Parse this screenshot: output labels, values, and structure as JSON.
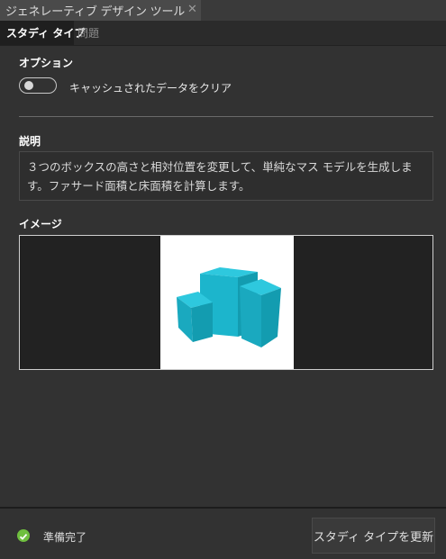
{
  "window": {
    "title": "ジェネレーティブ デザイン ツール",
    "close_glyph": "✕"
  },
  "tabs": [
    {
      "label": "スタディ タイプ",
      "active": true
    },
    {
      "label": "問題",
      "active": false
    }
  ],
  "options": {
    "heading": "オプション",
    "toggle_label": "キャッシュされたデータをクリア",
    "toggle_on": false
  },
  "description": {
    "heading": "説明",
    "text": "３つのボックスの高さと相対位置を変更して、単純なマス モデルを生成します。ファサード面積と床面積を計算します。"
  },
  "image": {
    "heading": "イメージ"
  },
  "status": {
    "icon": "check-circle-icon",
    "text": "準備完了"
  },
  "actions": {
    "update_label": "スタディ タイプを更新"
  },
  "colors": {
    "accent": "#1cb5cc",
    "status_ok": "#6fbf3f"
  }
}
